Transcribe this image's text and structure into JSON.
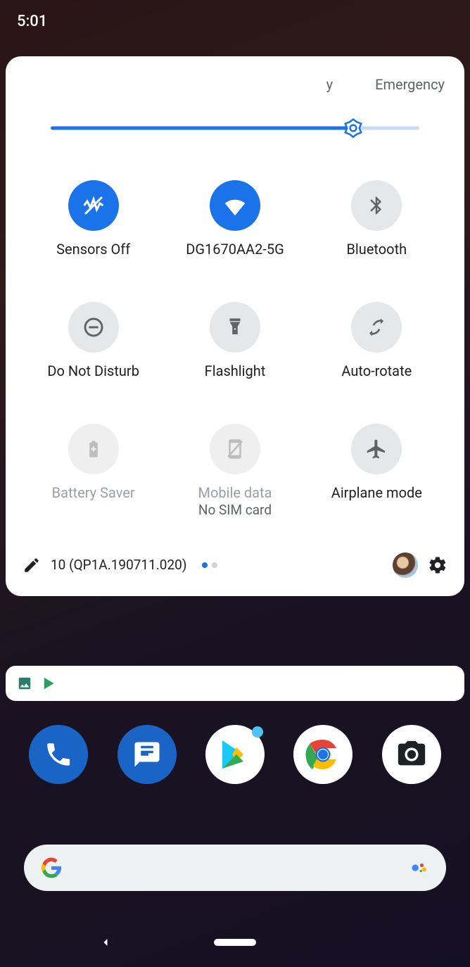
{
  "status": {
    "time": "5:01"
  },
  "qs": {
    "header": {
      "left": "y",
      "emergency": "Emergency"
    },
    "brightness": {
      "percent": 82
    },
    "tiles": [
      {
        "label": "Sensors Off",
        "sub": ""
      },
      {
        "label": "DG1670AA2-5G",
        "sub": ""
      },
      {
        "label": "Bluetooth",
        "sub": ""
      },
      {
        "label": "Do Not Disturb",
        "sub": ""
      },
      {
        "label": "Flashlight",
        "sub": ""
      },
      {
        "label": "Auto-rotate",
        "sub": ""
      },
      {
        "label": "Battery Saver",
        "sub": ""
      },
      {
        "label": "Mobile data",
        "sub": "No SIM card"
      },
      {
        "label": "Airplane mode",
        "sub": ""
      }
    ],
    "footer": {
      "build": "10 (QP1A.190711.020)"
    }
  }
}
